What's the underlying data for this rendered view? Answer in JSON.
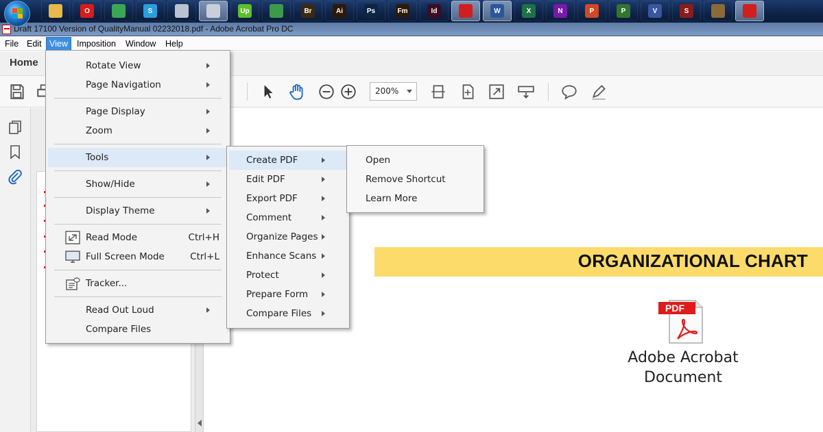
{
  "window": {
    "title": "Draft 17100 Version of QualityManual 02232018.pdf - Adobe Acrobat Pro DC"
  },
  "taskbar": {
    "apps": [
      {
        "name": "file-explorer-icon",
        "glyph": "",
        "color": "#e8b84a"
      },
      {
        "name": "opera-icon",
        "glyph": "O",
        "color": "#d91b1b"
      },
      {
        "name": "chrome-icon",
        "glyph": "",
        "color": "#3aa757"
      },
      {
        "name": "skype-icon",
        "glyph": "S",
        "color": "#2a9fe0"
      },
      {
        "name": "calculator-icon",
        "glyph": "",
        "color": "#b9c2cf"
      },
      {
        "name": "network-icon",
        "glyph": "",
        "color": "#c9cfda"
      },
      {
        "name": "upwork-icon",
        "glyph": "Up",
        "color": "#5bbf2b"
      },
      {
        "name": "document-app-icon",
        "glyph": "",
        "color": "#3c9b4a"
      },
      {
        "name": "bridge-icon",
        "glyph": "Br",
        "color": "#3a2a12"
      },
      {
        "name": "illustrator-icon",
        "glyph": "Ai",
        "color": "#2c1a05"
      },
      {
        "name": "photoshop-icon",
        "glyph": "Ps",
        "color": "#0c2542"
      },
      {
        "name": "framemaker-icon",
        "glyph": "Fm",
        "color": "#2d1a0c"
      },
      {
        "name": "indesign-icon",
        "glyph": "Id",
        "color": "#3a0d25"
      },
      {
        "name": "acrobat-icon",
        "glyph": "",
        "color": "#d11f1f"
      },
      {
        "name": "word-icon",
        "glyph": "W",
        "color": "#2b579a"
      },
      {
        "name": "excel-icon",
        "glyph": "X",
        "color": "#1e7145"
      },
      {
        "name": "onenote-icon",
        "glyph": "N",
        "color": "#7719aa"
      },
      {
        "name": "powerpoint-icon",
        "glyph": "P",
        "color": "#d24726"
      },
      {
        "name": "project-icon",
        "glyph": "P",
        "color": "#31752f"
      },
      {
        "name": "visio-icon",
        "glyph": "V",
        "color": "#3955a3"
      },
      {
        "name": "s-app-icon",
        "glyph": "S",
        "color": "#8a1c1c"
      },
      {
        "name": "library-icon",
        "glyph": "",
        "color": "#8a6a3a"
      },
      {
        "name": "acrobat-dc-icon",
        "glyph": "",
        "color": "#d11f1f"
      }
    ]
  },
  "menubar": {
    "file": "File",
    "edit": "Edit",
    "view": "View",
    "imposition": "Imposition",
    "window": "Window",
    "help": "Help"
  },
  "tabs": {
    "home": "Home"
  },
  "toolbar": {
    "zoom_value": "200%"
  },
  "view_menu": {
    "rotate_view": "Rotate View",
    "page_navigation": "Page Navigation",
    "page_display": "Page Display",
    "zoom": "Zoom",
    "tools": "Tools",
    "show_hide": "Show/Hide",
    "display_theme": "Display Theme",
    "read_mode": "Read Mode",
    "read_mode_shortcut": "Ctrl+H",
    "full_screen_mode": "Full Screen Mode",
    "full_screen_shortcut": "Ctrl+L",
    "tracker": "Tracker...",
    "read_out_loud": "Read Out Loud",
    "compare_files": "Compare Files"
  },
  "tools_submenu": {
    "items": [
      "Create PDF",
      "Edit PDF",
      "Export PDF",
      "Comment",
      "Organize Pages",
      "Enhance Scans",
      "Protect",
      "Prepare Form",
      "Compare Files"
    ]
  },
  "create_pdf_submenu": {
    "open": "Open",
    "remove_shortcut": "Remove Shortcut",
    "learn_more": "Learn More"
  },
  "document": {
    "heading": "ORGANIZATIONAL CHART",
    "attachment_line1": "Adobe Acrobat",
    "attachment_line2": "Document",
    "pdf_badge": "PDF"
  },
  "colors": {
    "banner": "#fddb6a",
    "menu_highlight": "#dce9f7",
    "menubar_open": "#3d8ee1",
    "acrobat_red": "#e01b1b"
  }
}
